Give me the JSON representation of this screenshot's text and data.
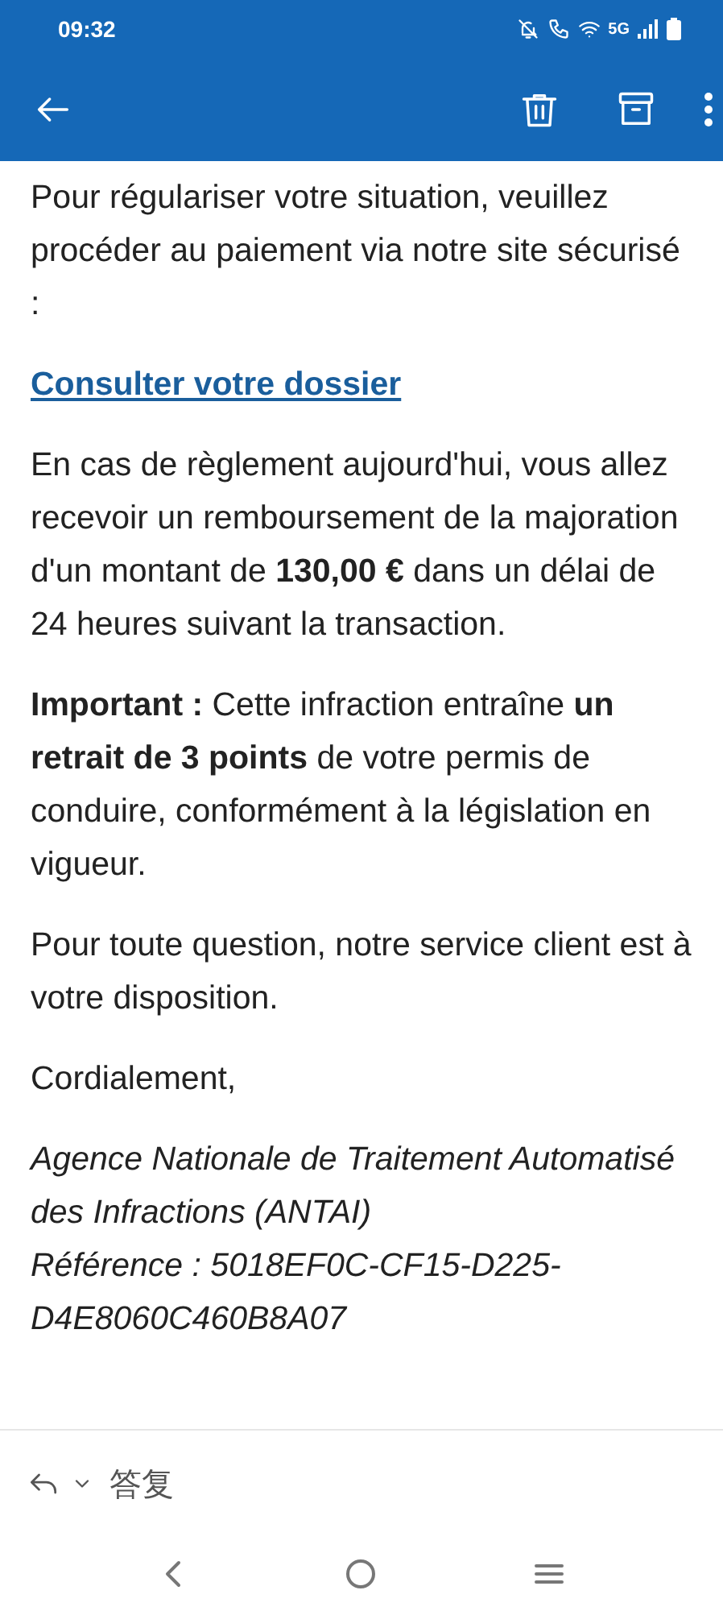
{
  "status_bar": {
    "time": "09:32",
    "network": "5G"
  },
  "body": [
    {
      "kind": "text",
      "text": "Pour régulariser votre situation, veuillez procéder au paiement via notre site sécurisé :"
    },
    {
      "kind": "link",
      "text": "Consulter votre dossier"
    },
    {
      "kind": "text",
      "text": "En cas de règlement aujourd'hui, vous allez recevoir un remboursement de la majoration d'un montant de **130,00 €** dans un délai de 24 heures suivant la transaction."
    },
    {
      "kind": "text",
      "text": "**Important :** Cette infraction entraîne **un retrait de 3 points** de votre permis de conduire, conformément à la législation en vigueur."
    },
    {
      "kind": "text",
      "text": "Pour toute question, notre service client est à votre disposition."
    },
    {
      "kind": "text",
      "text": "Cordialement,"
    },
    {
      "kind": "signature",
      "lines": [
        "Agence Nationale de Traitement Automatisé des Infractions (ANTAI)",
        "Référence : 5018EF0C-CF15-D225-D4E8060C460B8A07"
      ]
    }
  ],
  "reply_bar": {
    "label": "答复"
  }
}
